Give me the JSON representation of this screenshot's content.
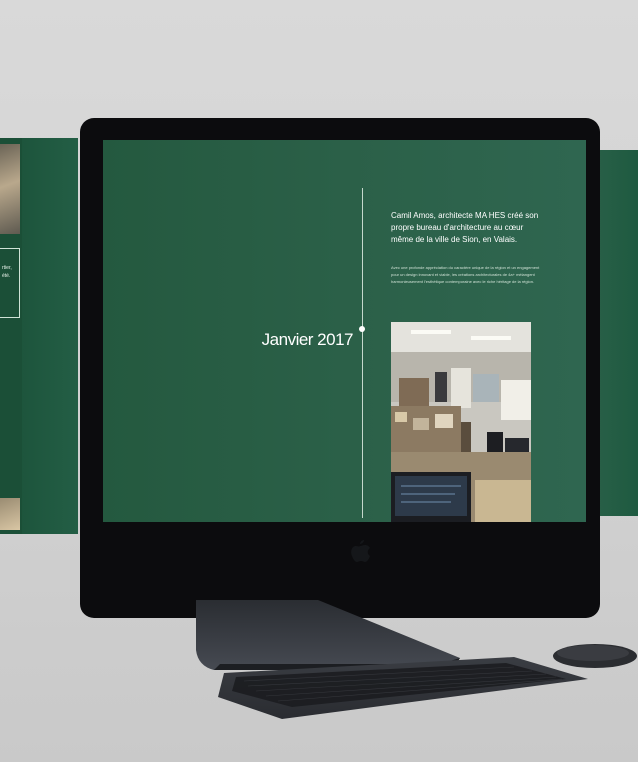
{
  "left_panel": {
    "lines": [
      "rtier,",
      "été."
    ]
  },
  "screen": {
    "date": "Janvier 2017",
    "headline": "Camil Amos, architecte MA HES créé son propre bureau d'architecture au cœur même de la ville de Sion, en Valais.",
    "body": "Avec une profonde appréciation du caractère unique de la région et un engagement pour un design innovant et viable, les créations architecturales de 4a+ mélangent harmonieusement l'esthétique contemporaine avec le riche héritage de la région."
  },
  "icons": {
    "brand_logo": "apple-logo-icon"
  },
  "colors": {
    "screen_green": "#2b6048",
    "panel_green": "#1e5a40",
    "imac_chin": "#2e3238"
  }
}
